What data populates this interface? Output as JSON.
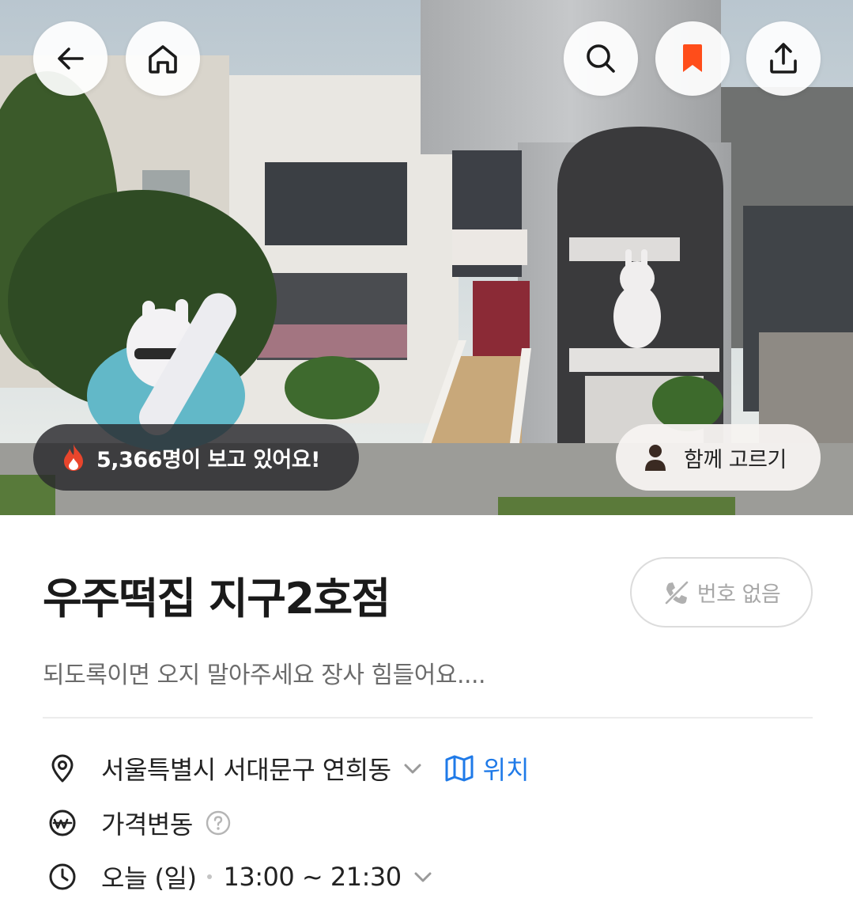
{
  "header": {
    "back_icon": "arrow-left-icon",
    "home_icon": "home-icon",
    "search_icon": "search-icon",
    "bookmark_icon": "bookmark-icon",
    "share_icon": "share-icon",
    "bookmark_color": "#ff4d1a"
  },
  "hero": {
    "viewers_text": "5,366명이 보고 있어요!",
    "viewers_icon": "fire-icon",
    "together_label": "함께 고르기",
    "together_icon": "person-icon"
  },
  "place": {
    "name": "우주떡집 지구2호점",
    "phone_label": "번호 없음",
    "phone_icon": "no-phone-icon",
    "description": "되도록이면 오지 말아주세요 장사 힘들어요...."
  },
  "details": {
    "address": "서울특별시 서대문구 연희동",
    "map_label": "위치",
    "price_label": "가격변동",
    "hours_day": "오늘 (일)",
    "hours_time": "13:00 ~ 21:30"
  },
  "colors": {
    "accent_blue": "#1f7ae8",
    "fire": "#e8452c"
  }
}
